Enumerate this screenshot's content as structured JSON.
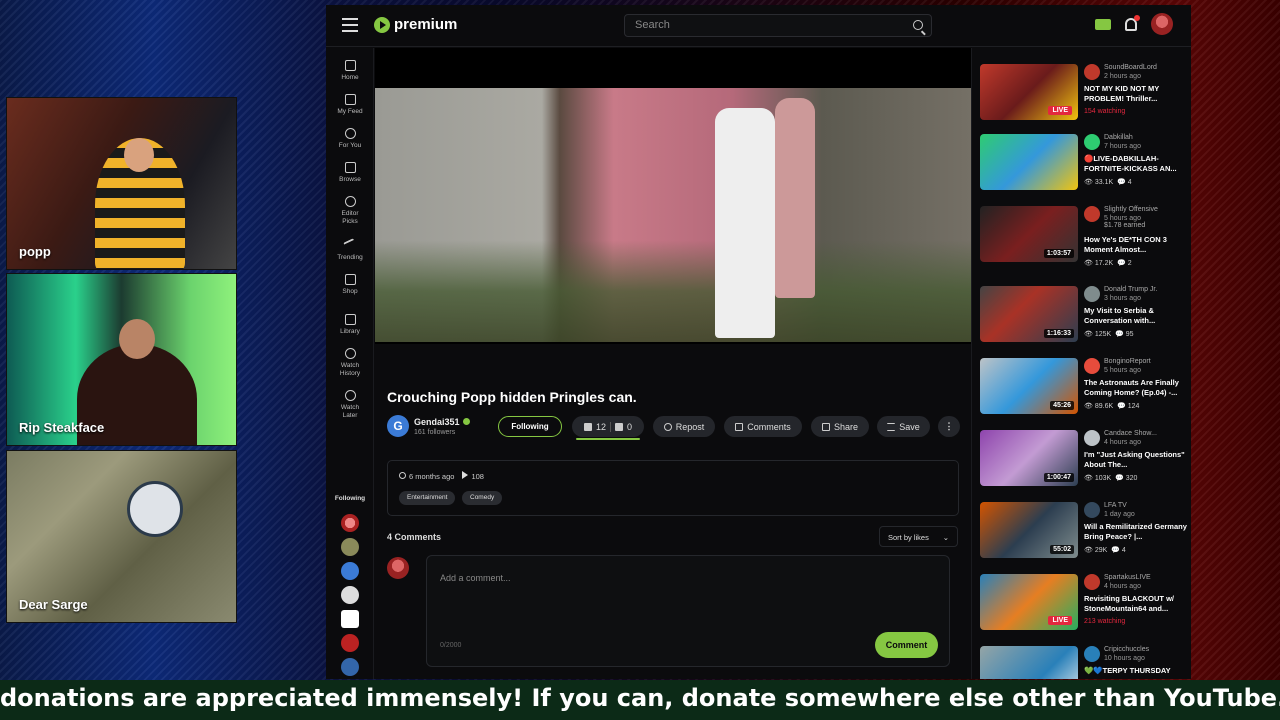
{
  "webcams": [
    {
      "name": "popp"
    },
    {
      "name": "Rip Steakface"
    },
    {
      "name": "Dear Sarge"
    }
  ],
  "topbar": {
    "logo_text": "premium",
    "search_placeholder": "Search"
  },
  "sidebar": {
    "items": [
      {
        "label": "Home",
        "icon": "home-icon"
      },
      {
        "label": "My Feed",
        "icon": "feed-icon"
      },
      {
        "label": "For You",
        "icon": "for-you-icon"
      },
      {
        "label": "Browse",
        "icon": "browse-icon"
      },
      {
        "label": "Editor Picks",
        "icon": "editor-picks-icon"
      },
      {
        "label": "Trending",
        "icon": "trending-icon"
      },
      {
        "label": "Shop",
        "icon": "shop-icon"
      },
      {
        "label": "Library",
        "icon": "library-icon"
      },
      {
        "label": "Watch History",
        "icon": "history-icon"
      },
      {
        "label": "Watch Later",
        "icon": "watch-later-icon"
      }
    ],
    "following_label": "Following"
  },
  "video": {
    "title": "Crouching Popp hidden Pringles can.",
    "channel": "Gendai351",
    "channel_initial": "G",
    "followers": "161 followers",
    "follow_label": "Following",
    "likes": "12",
    "dislikes": "0",
    "repost_label": "Repost",
    "comments_label": "Comments",
    "share_label": "Share",
    "save_label": "Save",
    "posted": "6 months ago",
    "views": "108",
    "tags": [
      "Entertainment",
      "Comedy"
    ]
  },
  "comments": {
    "title": "4 Comments",
    "sort_label": "Sort by likes",
    "placeholder": "Add a comment...",
    "char_count": "0/2000",
    "submit_label": "Comment"
  },
  "related": [
    {
      "channel": "SoundBoardLord",
      "time": "2 hours ago",
      "title": "NOT MY KID NOT MY PROBLEM! Thriller...",
      "live": "LIVE",
      "watching": "154 watching",
      "avatar_color": "#c0392b"
    },
    {
      "channel": "Dabkillah",
      "time": "7 hours ago",
      "title": "🔴LIVE-DABKILLAH-FORTNITE-KICKASS AN...",
      "views": "33.1K",
      "comments": "4",
      "avatar_color": "#2ecc71"
    },
    {
      "channel": "Slightly Offensive",
      "time": "5 hours ago",
      "earned": "$1.78 earned",
      "title": "How Ye's DE*TH CON 3 Moment Almost...",
      "duration": "1:03:57",
      "views": "17.2K",
      "comments": "2",
      "avatar_color": "#c0392b"
    },
    {
      "channel": "Donald Trump Jr.",
      "time": "3 hours ago",
      "title": "My Visit to Serbia & Conversation with...",
      "duration": "1:16:33",
      "views": "125K",
      "comments": "95",
      "avatar_color": "#7f8c8d"
    },
    {
      "channel": "BonginoReport",
      "time": "5 hours ago",
      "title": "The Astronauts Are Finally Coming Home? (Ep.04) -...",
      "duration": "45:26",
      "views": "89.6K",
      "comments": "124",
      "avatar_color": "#e74c3c"
    },
    {
      "channel": "Candace Show...",
      "time": "4 hours ago",
      "title": "I'm \"Just Asking Questions\" About The...",
      "duration": "1:00:47",
      "views": "103K",
      "comments": "320",
      "avatar_color": "#bdc3c7"
    },
    {
      "channel": "LFA TV",
      "time": "1 day ago",
      "title": "Will a Remilitarized Germany Bring Peace? |...",
      "duration": "55:02",
      "views": "29K",
      "comments": "4",
      "avatar_color": "#34495e"
    },
    {
      "channel": "SpartakusLIVE",
      "time": "4 hours ago",
      "title": "Revisiting BLACKOUT w/ StoneMountain64 and...",
      "live": "LIVE",
      "watching": "213 watching",
      "avatar_color": "#c0392b"
    },
    {
      "channel": "Cripicchuccles",
      "time": "10 hours ago",
      "title": "💚💙TERPY THURSDAY",
      "avatar_color": "#2980b9"
    }
  ],
  "ticker": {
    "text": "donations are appreciated immensely! If you can, donate somewhere else other than YouTube. We truly are"
  },
  "colors": {
    "accent": "#85c742",
    "live": "#e3283e",
    "ticker_bg": "#0c2a17"
  }
}
